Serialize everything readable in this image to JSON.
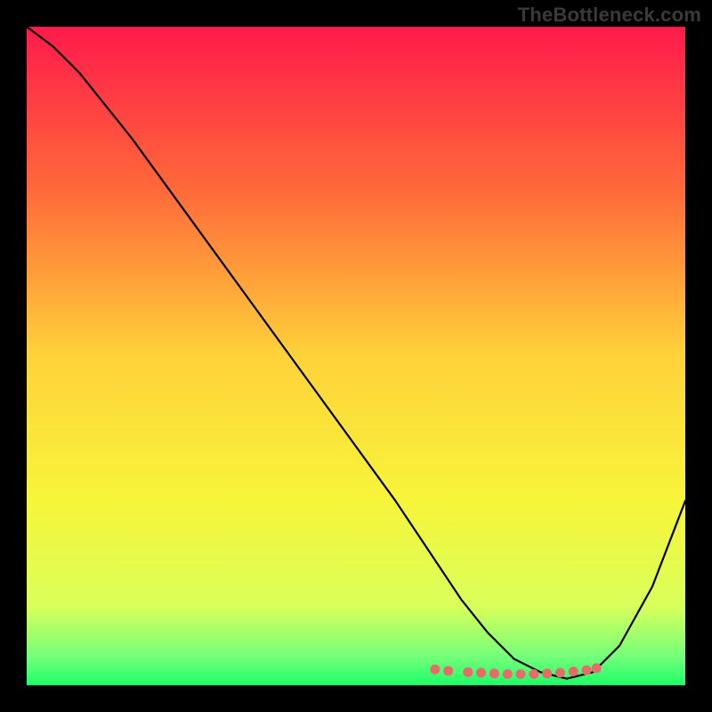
{
  "watermark": "TheBottleneck.com",
  "chart_data": {
    "type": "line",
    "title": "",
    "xlabel": "",
    "ylabel": "",
    "xlim": [
      0,
      100
    ],
    "ylim": [
      0,
      100
    ],
    "grid": false,
    "legend": false,
    "series": [
      {
        "name": "curve",
        "color": "#000000",
        "x": [
          0,
          4,
          8,
          16,
          24,
          32,
          40,
          48,
          56,
          62,
          66,
          70,
          74,
          78,
          82,
          86,
          90,
          95,
          100
        ],
        "y": [
          100,
          97,
          93,
          83,
          72,
          61,
          50,
          39,
          28,
          19,
          13,
          8,
          4,
          2,
          1,
          2,
          6,
          15,
          28
        ]
      }
    ],
    "markers": {
      "name": "bottom-dots",
      "color": "#e86b6b",
      "points": [
        {
          "x": 62,
          "y": 2.4
        },
        {
          "x": 64,
          "y": 2.2
        },
        {
          "x": 67,
          "y": 2.0
        },
        {
          "x": 69,
          "y": 1.9
        },
        {
          "x": 71,
          "y": 1.8
        },
        {
          "x": 73,
          "y": 1.7
        },
        {
          "x": 75,
          "y": 1.7
        },
        {
          "x": 77,
          "y": 1.7
        },
        {
          "x": 79,
          "y": 1.8
        },
        {
          "x": 81,
          "y": 1.9
        },
        {
          "x": 83,
          "y": 2.1
        },
        {
          "x": 85,
          "y": 2.3
        },
        {
          "x": 86.5,
          "y": 2.6
        }
      ]
    },
    "gradient_stops": [
      {
        "offset": 0.0,
        "color": "#ff1a4b"
      },
      {
        "offset": 0.25,
        "color": "#ff6a3a"
      },
      {
        "offset": 0.5,
        "color": "#ffd23a"
      },
      {
        "offset": 0.72,
        "color": "#f7f53a"
      },
      {
        "offset": 0.88,
        "color": "#d9ff5a"
      },
      {
        "offset": 0.96,
        "color": "#6fff7a"
      },
      {
        "offset": 1.0,
        "color": "#1cff67"
      }
    ]
  }
}
